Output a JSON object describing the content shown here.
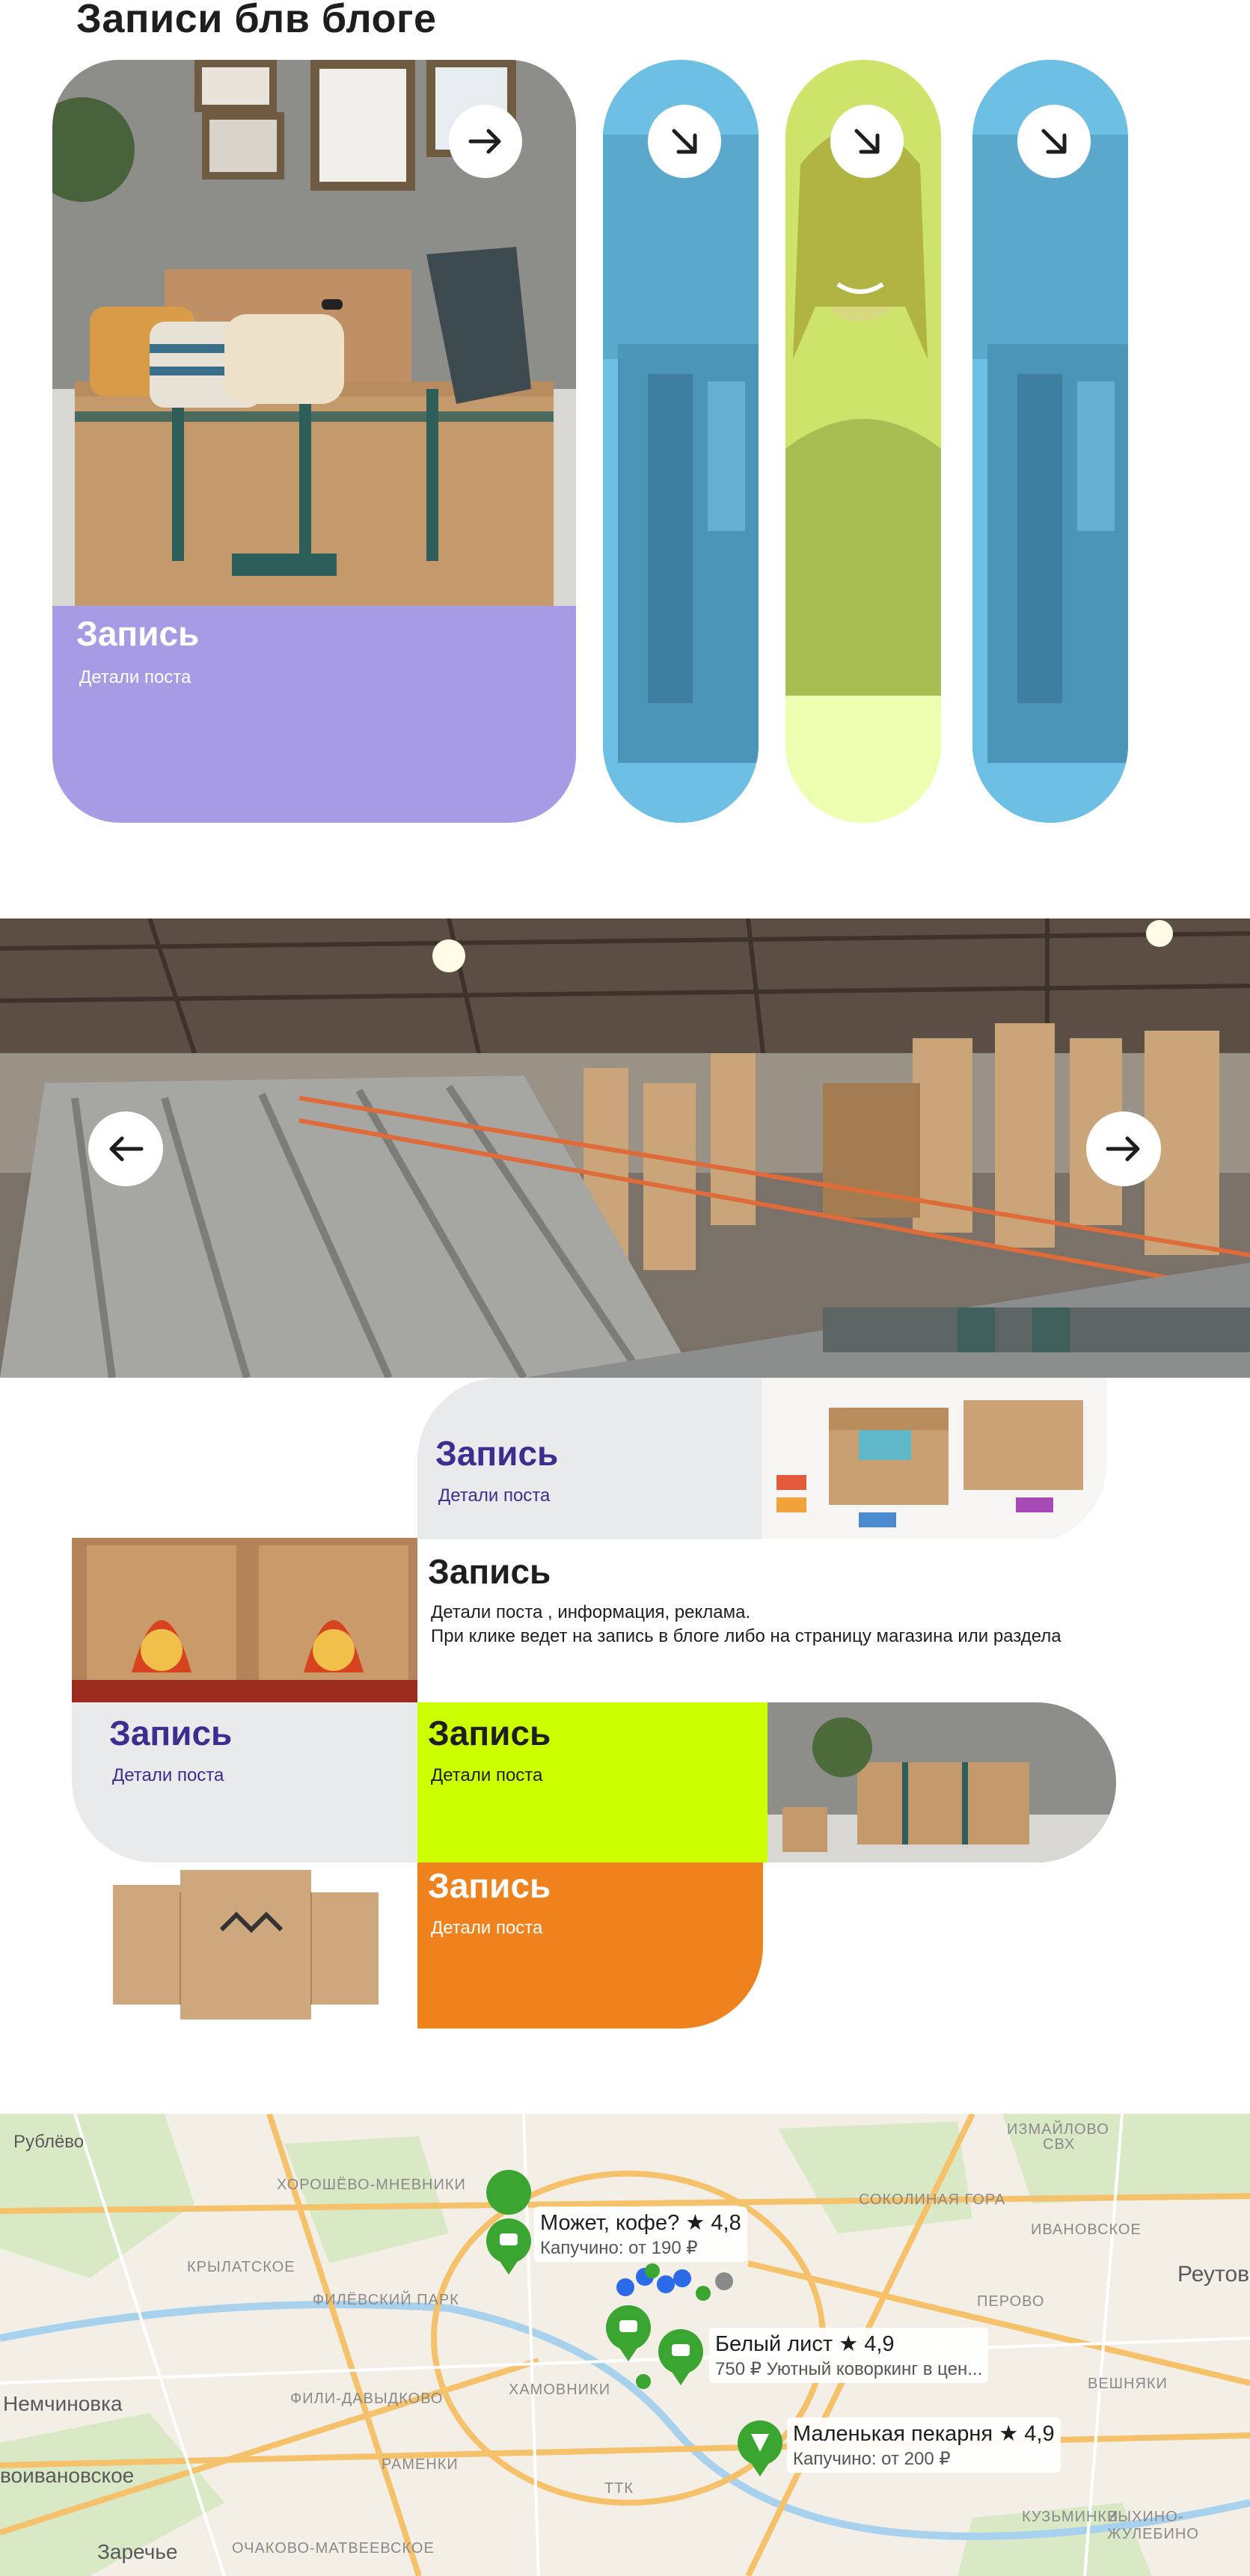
{
  "page": {
    "title": "Записи блв блоге"
  },
  "blog_cards": {
    "featured": {
      "title": "Запись",
      "subtitle": "Детали поста",
      "image": "cardboard-furniture-living-room"
    },
    "pills": [
      {
        "image": "cardboard-box-closeup",
        "tint": "#7ecef0"
      },
      {
        "image": "smiling-woman",
        "tint": "#e6ff7a"
      },
      {
        "image": "cardboard-box-closeup",
        "tint": "#7ecef0"
      }
    ],
    "arrow_icon": "arrow-right-icon",
    "diag_arrow_icon": "arrow-down-right-icon"
  },
  "hero": {
    "image": "cardboard-factory-interior",
    "prev_icon": "arrow-left-icon",
    "next_icon": "arrow-right-icon"
  },
  "grid": {
    "tile1": {
      "title": "Запись",
      "subtitle": "Детали поста"
    },
    "tile2": {
      "title": "Запись",
      "subtitle": "Детали поста , информация, реклама.",
      "subtitle2": "При клике ведет  на запись в блоге либо  на страницу магазина или раздела"
    },
    "tile3": {
      "title": "Запись",
      "subtitle": "Детали поста"
    },
    "tile4": {
      "title": "Запись",
      "subtitle": "Детали поста"
    },
    "tile5": {
      "title": "Запись",
      "subtitle": "Детали поста"
    }
  },
  "colors": {
    "purple": "#a89be5",
    "lime": "#ccff00",
    "orange": "#f0821e",
    "gray": "#e8eaeb",
    "dark_purple": "#3c2d91",
    "blue": "#7ecef0"
  },
  "map": {
    "places": [
      "Рублёво",
      "Немчиновка",
      "воивановское",
      "Заречье",
      "Реутов"
    ],
    "districts": [
      "ХОРОШЁВО-МНЕВНИКИ",
      "КРЫЛАТСКОЕ",
      "ФИЛЁВСКИЙ ПАРК",
      "ФИЛИ-ДАВЫДКОВО",
      "ХАМОВНИКИ",
      "РАМЕНКИ",
      "ОЧАКОВО-МАТВЕЕВСКОЕ",
      "СОКОЛИНАЯ ГОРА",
      "ИВАНОВСКОЕ",
      "ПЕРОВО",
      "ВЕШНЯКИ",
      "КУЗЬМИНКИ",
      "ВЫХИНО-ЖУЛЕБИНО",
      "ИЗМАЙЛОВО"
    ],
    "roads": [
      "ТТК",
      "СВХ"
    ],
    "pins": [
      {
        "name": "Может, кофе?",
        "rating": "★ 4,8",
        "desc": "Капучино: от 190 ₽"
      },
      {
        "name": "Белый лист",
        "rating": "★ 4,9",
        "desc": "750 ₽ Уютный коворкинг в цен..."
      },
      {
        "name": "Маленькая пекарня",
        "rating": "★ 4,9",
        "desc": "Капучино: от 200 ₽"
      }
    ]
  }
}
